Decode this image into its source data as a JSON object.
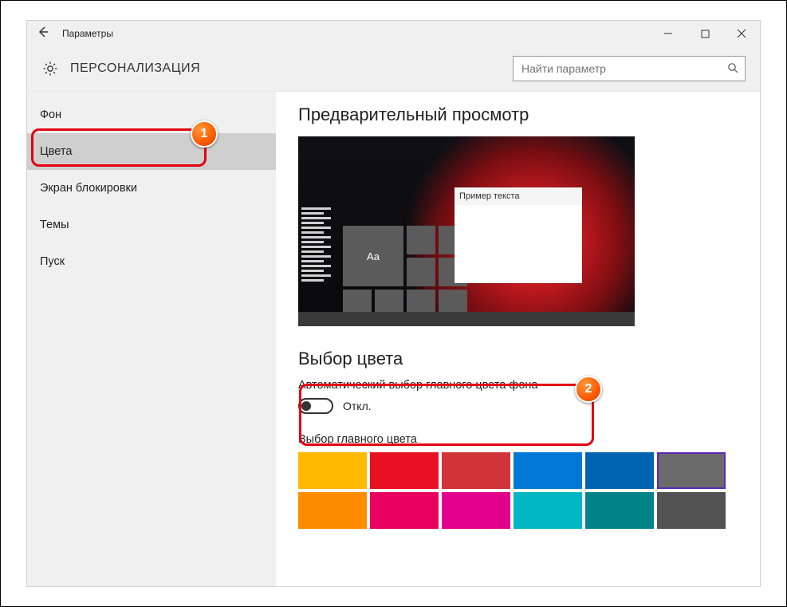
{
  "window": {
    "title": "Параметры"
  },
  "header": {
    "heading": "ПЕРСОНАЛИЗАЦИЯ",
    "search_placeholder": "Найти параметр"
  },
  "sidebar": {
    "items": [
      {
        "label": "Фон",
        "selected": false
      },
      {
        "label": "Цвета",
        "selected": true
      },
      {
        "label": "Экран блокировки",
        "selected": false
      },
      {
        "label": "Темы",
        "selected": false
      },
      {
        "label": "Пуск",
        "selected": false
      }
    ]
  },
  "content": {
    "preview_heading": "Предварительный просмотр",
    "preview_sample_text": "Пример текста",
    "preview_tile_text": "Aa",
    "color_choice_heading": "Выбор цвета",
    "auto_color_label": "Автоматический выбор главного цвета фона",
    "auto_color_state": "Откл.",
    "main_color_label": "Выбор главного цвета",
    "swatches": [
      {
        "hex": "#ffb900",
        "selected": false
      },
      {
        "hex": "#e81123",
        "selected": false
      },
      {
        "hex": "#d13438",
        "selected": false
      },
      {
        "hex": "#0078d7",
        "selected": false
      },
      {
        "hex": "#0063b1",
        "selected": false
      },
      {
        "hex": "#6b6b6b",
        "selected": true
      },
      {
        "hex": "#ff8c00",
        "selected": false
      },
      {
        "hex": "#ea005e",
        "selected": false
      },
      {
        "hex": "#e3008c",
        "selected": false
      },
      {
        "hex": "#00b7c3",
        "selected": false
      },
      {
        "hex": "#038387",
        "selected": false
      },
      {
        "hex": "#525252",
        "selected": false
      }
    ]
  },
  "callouts": {
    "one": "1",
    "two": "2"
  }
}
